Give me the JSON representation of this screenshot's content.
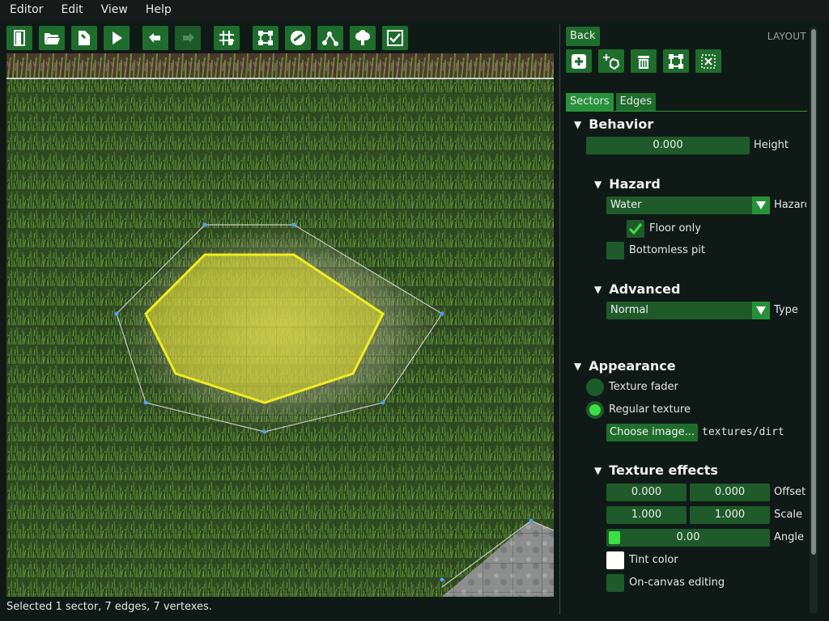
{
  "menu": [
    "Editor",
    "Edit",
    "View",
    "Help"
  ],
  "toolbar": [
    {
      "icon": "exit-icon"
    },
    {
      "icon": "folder-open-icon"
    },
    {
      "icon": "save-icon"
    },
    {
      "icon": "play-icon"
    },
    {
      "icon": "undo-icon"
    },
    {
      "icon": "redo-icon"
    },
    {
      "icon": "grid-snap-icon"
    },
    {
      "icon": "layout-icon"
    },
    {
      "icon": "mob-icon"
    },
    {
      "icon": "path-icon"
    },
    {
      "icon": "tree-icon"
    },
    {
      "icon": "check-icon"
    }
  ],
  "status": "Selected 1 sector, 7 edges, 7 vertexes.",
  "panel": {
    "back_label": "Back",
    "title": "LAYOUT",
    "tabs": [
      "Sectors",
      "Edges"
    ],
    "behavior": {
      "header": "Behavior",
      "height_value": "0.000",
      "height_label": "Height",
      "hazard": {
        "header": "Hazard",
        "hazard_value": "Water",
        "hazard_label": "Hazard",
        "floor_only_label": "Floor only",
        "floor_only_checked": true,
        "bottomless_label": "Bottomless pit",
        "bottomless_checked": false
      },
      "advanced": {
        "header": "Advanced",
        "type_value": "Normal",
        "type_label": "Type"
      }
    },
    "appearance": {
      "header": "Appearance",
      "texture_fader_label": "Texture fader",
      "regular_texture_label": "Regular texture",
      "selected_mode": "regular",
      "choose_image_label": "Choose image...",
      "texture_path": "textures/dirt",
      "effects": {
        "header": "Texture effects",
        "offset_x": "0.000",
        "offset_y": "0.000",
        "offset_label": "Offset",
        "scale_x": "1.000",
        "scale_y": "1.000",
        "scale_label": "Scale",
        "angle_value": "0.00",
        "angle_label": "Angle",
        "tint_label": "Tint color",
        "tint_color": "#ffffff",
        "on_canvas_label": "On-canvas editing"
      }
    }
  },
  "colors": {
    "accent": "#1f6d2c",
    "accent_bright": "#3ede46",
    "selection": "#e3e02a"
  }
}
